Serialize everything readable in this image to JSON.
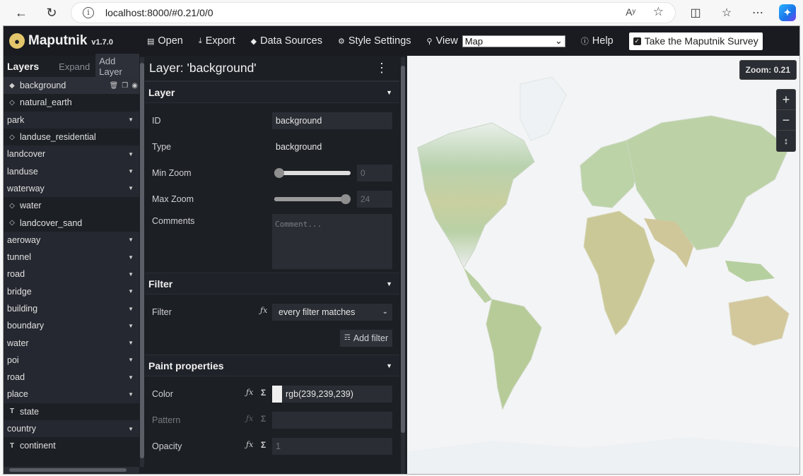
{
  "browser": {
    "url": "localhost:8000/#0.21/0/0",
    "read_aloud": "Aʸ"
  },
  "toolbar": {
    "app_name": "Maputnik",
    "version": "v1.7.0",
    "open": "Open",
    "export": "Export",
    "data_sources": "Data Sources",
    "style_settings": "Style Settings",
    "view": "View",
    "view_selected": "Map",
    "help": "Help",
    "survey": "Take the Maputnik Survey"
  },
  "layers_panel": {
    "title": "Layers",
    "expand": "Expand",
    "add_layer": "Add Layer",
    "items": [
      {
        "label": "background",
        "kind": "fill-solid",
        "selected": true
      },
      {
        "label": "natural_earth",
        "kind": "fill-outline"
      },
      {
        "label": "park",
        "kind": "group"
      },
      {
        "label": "landuse_residential",
        "kind": "fill-outline"
      },
      {
        "label": "landcover",
        "kind": "group"
      },
      {
        "label": "landuse",
        "kind": "group"
      },
      {
        "label": "waterway",
        "kind": "group"
      },
      {
        "label": "water",
        "kind": "fill-outline"
      },
      {
        "label": "landcover_sand",
        "kind": "fill-outline"
      },
      {
        "label": "aeroway",
        "kind": "group"
      },
      {
        "label": "tunnel",
        "kind": "group"
      },
      {
        "label": "road",
        "kind": "group"
      },
      {
        "label": "bridge",
        "kind": "group"
      },
      {
        "label": "building",
        "kind": "group"
      },
      {
        "label": "boundary",
        "kind": "group"
      },
      {
        "label": "water",
        "kind": "group"
      },
      {
        "label": "poi",
        "kind": "group"
      },
      {
        "label": "road",
        "kind": "group"
      },
      {
        "label": "place",
        "kind": "group"
      },
      {
        "label": "state",
        "kind": "symbol"
      },
      {
        "label": "country",
        "kind": "group"
      },
      {
        "label": "continent",
        "kind": "symbol"
      }
    ]
  },
  "editor": {
    "title": "Layer: 'background'",
    "layer_section": {
      "title": "Layer",
      "id_label": "ID",
      "id_value": "background",
      "type_label": "Type",
      "type_value": "background",
      "min_zoom_label": "Min Zoom",
      "min_zoom_value": "0",
      "min_zoom_fraction": 0,
      "max_zoom_label": "Max Zoom",
      "max_zoom_value": "24",
      "max_zoom_fraction": 1,
      "comments_label": "Comments",
      "comments_placeholder": "Comment..."
    },
    "filter_section": {
      "title": "Filter",
      "filter_label": "Filter",
      "filter_value": "every filter matches",
      "add_filter": "Add filter"
    },
    "paint_section": {
      "title": "Paint properties",
      "color_label": "Color",
      "color_value": "rgb(239,239,239)",
      "pattern_label": "Pattern",
      "opacity_label": "Opacity",
      "opacity_value": "1"
    }
  },
  "map": {
    "zoom_label": "Zoom: 0.21"
  }
}
